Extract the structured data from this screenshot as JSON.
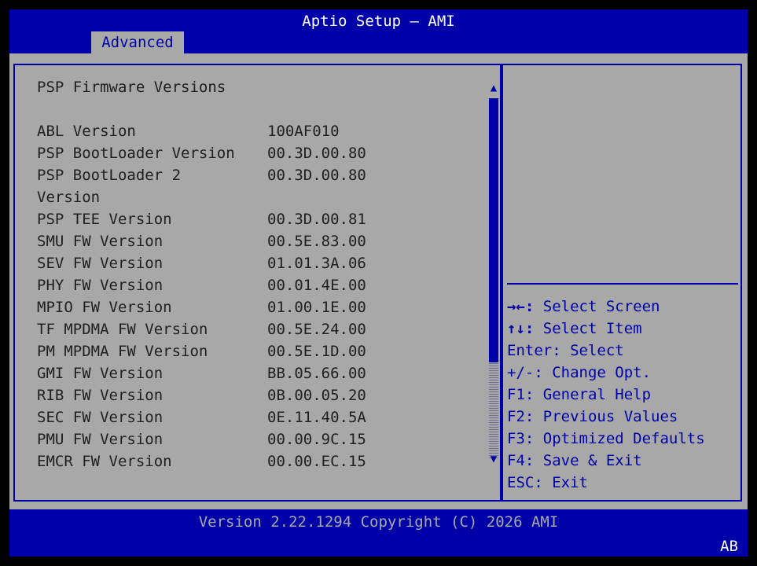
{
  "app": {
    "title": "Aptio Setup – AMI",
    "active_tab": "Advanced"
  },
  "section_title": "PSP Firmware Versions",
  "versions": [
    {
      "label": "ABL Version",
      "value": "100AF010"
    },
    {
      "label": "PSP BootLoader Version",
      "value": "00.3D.00.80"
    },
    {
      "label": "PSP BootLoader 2\nVersion",
      "value": "00.3D.00.80"
    },
    {
      "label": "PSP TEE Version",
      "value": "00.3D.00.81"
    },
    {
      "label": "SMU FW Version",
      "value": "00.5E.83.00"
    },
    {
      "label": "SEV FW Version",
      "value": "01.01.3A.06"
    },
    {
      "label": "PHY FW Version",
      "value": "00.01.4E.00"
    },
    {
      "label": "MPIO FW Version",
      "value": "01.00.1E.00"
    },
    {
      "label": "TF MPDMA FW Version",
      "value": "00.5E.24.00"
    },
    {
      "label": "PM MPDMA FW Version",
      "value": "00.5E.1D.00"
    },
    {
      "label": "GMI FW Version",
      "value": "BB.05.66.00"
    },
    {
      "label": "RIB FW Version",
      "value": "0B.00.05.20"
    },
    {
      "label": "SEC FW Version",
      "value": "0E.11.40.5A"
    },
    {
      "label": "PMU FW Version",
      "value": "00.00.9C.15"
    },
    {
      "label": "EMCR FW Version",
      "value": "00.00.EC.15"
    }
  ],
  "scrollbar": {
    "up_arrow": "▲",
    "down_arrow": "▼"
  },
  "help": [
    {
      "key": "→←:",
      "text": " Select Screen"
    },
    {
      "key": "↑↓:",
      "text": " Select Item"
    },
    {
      "key": "",
      "text": "Enter: Select"
    },
    {
      "key": "",
      "text": "+/-: Change Opt."
    },
    {
      "key": "",
      "text": "F1: General Help"
    },
    {
      "key": "",
      "text": "F2: Previous Values"
    },
    {
      "key": "",
      "text": "F3: Optimized Defaults"
    },
    {
      "key": "",
      "text": "F4: Save & Exit"
    },
    {
      "key": "",
      "text": "ESC: Exit"
    }
  ],
  "footer": {
    "version": "Version 2.22.1294 Copyright (C) 2026 AMI",
    "corner": "AB"
  },
  "colors": {
    "bar_blue": "#0000a8",
    "panel_gray": "#a8a8a8",
    "text_dark": "#202020",
    "text_white": "#ffffff"
  }
}
